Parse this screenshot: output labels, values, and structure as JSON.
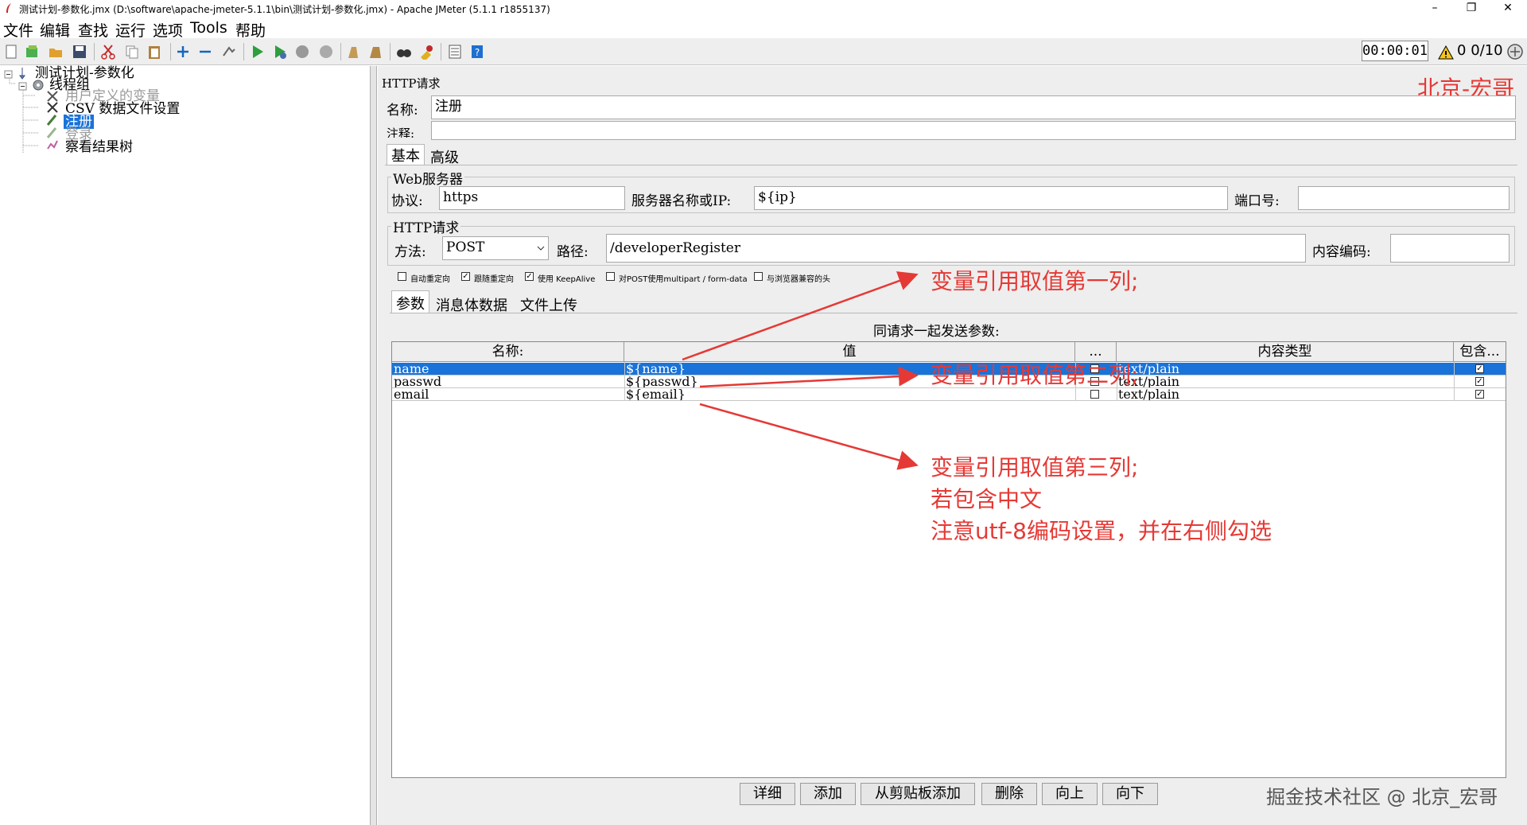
{
  "window": {
    "title": "测试计划-参数化.jmx (D:\\software\\apache-jmeter-5.1.1\\bin\\测试计划-参数化.jmx) - Apache JMeter (5.1.1 r1855137)",
    "minimize": "–",
    "restore": "❐",
    "close": "✕"
  },
  "menu": [
    "文件",
    "编辑",
    "查找",
    "运行",
    "选项",
    "Tools",
    "帮助"
  ],
  "toolbar": {
    "timer": "00:00:01",
    "warnings": "0",
    "threads": "0/10"
  },
  "tree": {
    "plan": "测试计划-参数化",
    "thread_group": "线程组",
    "user_vars": "用户定义的变量",
    "csv": "CSV 数据文件设置",
    "register": "注册",
    "login": "登录",
    "results": "察看结果树"
  },
  "panel": {
    "title": "HTTP请求",
    "name_label": "名称:",
    "name_value": "注册",
    "comment_label": "注释:",
    "watermark": "北京-宏哥",
    "tabs": [
      "基本",
      "高级"
    ],
    "web_server": {
      "legend": "Web服务器",
      "protocol_label": "协议:",
      "protocol_value": "https",
      "server_label": "服务器名称或IP:",
      "server_value": "${ip}",
      "port_label": "端口号:",
      "port_value": ""
    },
    "http_request": {
      "legend": "HTTP请求",
      "method_label": "方法:",
      "method_value": "POST",
      "path_label": "路径:",
      "path_value": "/developerRegister",
      "encoding_label": "内容编码:",
      "encoding_value": ""
    },
    "checkboxes": [
      {
        "label": "自动重定向",
        "checked": false
      },
      {
        "label": "跟随重定向",
        "checked": true
      },
      {
        "label": "使用 KeepAlive",
        "checked": true
      },
      {
        "label": "对POST使用multipart / form-data",
        "checked": false
      },
      {
        "label": "与浏览器兼容的头",
        "checked": false
      }
    ],
    "param_tabs": [
      "参数",
      "消息体数据",
      "文件上传"
    ],
    "send_with_request": "同请求一起发送参数:",
    "table": {
      "headers": [
        "名称:",
        "值",
        "...",
        "内容类型",
        "包含..."
      ],
      "rows": [
        {
          "name": "name",
          "value": "${name}",
          "encode": false,
          "content_type": "text/plain",
          "include": true,
          "selected": true
        },
        {
          "name": "passwd",
          "value": "${passwd}",
          "encode": false,
          "content_type": "text/plain",
          "include": true,
          "selected": false
        },
        {
          "name": "email",
          "value": "${email}",
          "encode": false,
          "content_type": "text/plain",
          "include": true,
          "selected": false
        }
      ]
    },
    "buttons": [
      "详细",
      "添加",
      "从剪贴板添加",
      "删除",
      "向上",
      "向下"
    ]
  },
  "annotations": {
    "col1": "变量引用取值第一列;",
    "col2": "变量引用取值第二列;",
    "col3_line1": "变量引用取值第三列;",
    "col3_line2": "若包含中文",
    "col3_line3": "注意utf-8编码设置，并在右侧勾选"
  },
  "footer_watermark": "掘金技术社区 @ 北京_宏哥",
  "colors": {
    "selection": "#1a73d9",
    "annotation": "#e53935",
    "panel_bg": "#eeeeee"
  }
}
